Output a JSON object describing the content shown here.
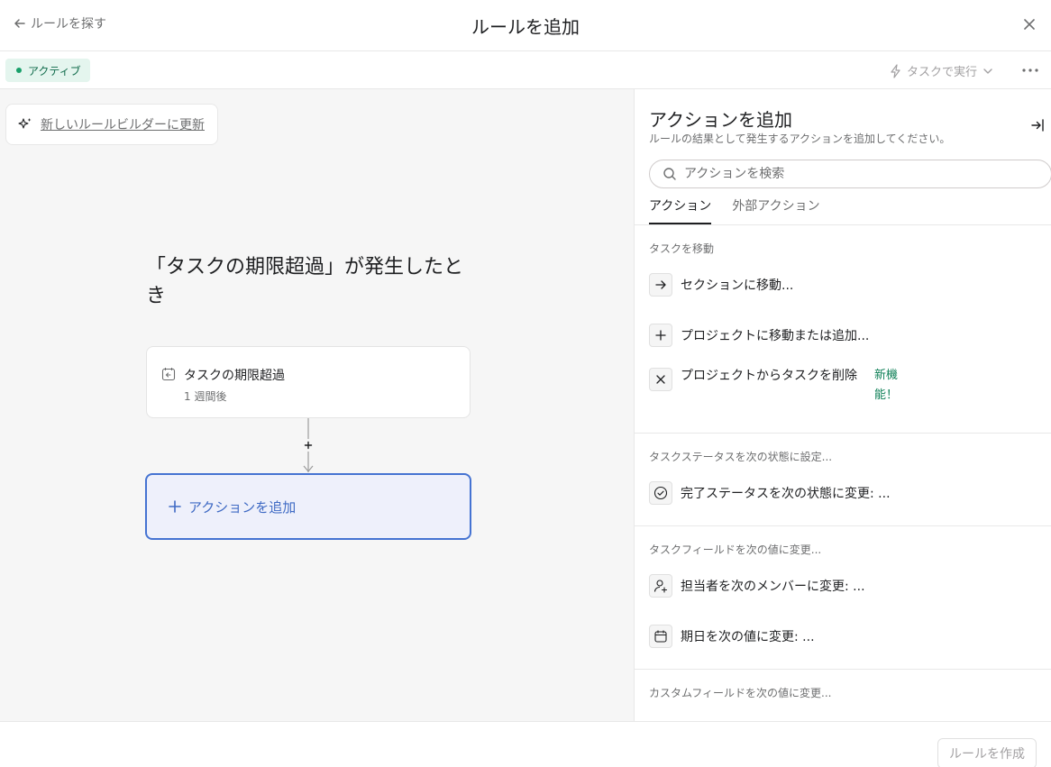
{
  "header": {
    "back_label": "ルールを探す",
    "title": "ルールを追加"
  },
  "subbar": {
    "status": "アクティブ",
    "run_label": "タスクで実行"
  },
  "canvas": {
    "upgrade_label": "新しいルールビルダーに更新",
    "trigger_heading": "「タスクの期限超過」が発生したとき",
    "trigger_card": {
      "title": "タスクの期限超過",
      "subtitle": "1 週間後"
    },
    "add_action_label": "アクションを追加"
  },
  "panel": {
    "title": "アクションを追加",
    "description": "ルールの結果として発生するアクションを追加してください。",
    "search_placeholder": "アクションを検索",
    "tabs": [
      {
        "label": "アクション",
        "active": true
      },
      {
        "label": "外部アクション",
        "active": false
      }
    ],
    "sections": [
      {
        "title": "タスクを移動",
        "items": [
          {
            "label": "セクションに移動...",
            "icon": "arrow-right-icon"
          },
          {
            "label": "プロジェクトに移動または追加...",
            "icon": "plus-icon"
          },
          {
            "label": "プロジェクトからタスクを削除",
            "icon": "x-icon",
            "badge": "新機能！"
          }
        ]
      },
      {
        "title": "タスクステータスを次の状態に設定...",
        "items": [
          {
            "label": "完了ステータスを次の状態に変更: ...",
            "icon": "check-circle-icon"
          }
        ]
      },
      {
        "title": "タスクフィールドを次の値に変更...",
        "items": [
          {
            "label": "担当者を次のメンバーに変更: ...",
            "icon": "user-add-icon"
          },
          {
            "label": "期日を次の値に変更: ...",
            "icon": "calendar-icon"
          }
        ]
      },
      {
        "title": "カスタムフィールドを次の値に変更...",
        "items": []
      }
    ]
  },
  "footer": {
    "create_label": "ルールを作成"
  },
  "colors": {
    "accent": "#4573d2",
    "status_green": "#18a06a",
    "new_badge": "#0d7f56"
  }
}
